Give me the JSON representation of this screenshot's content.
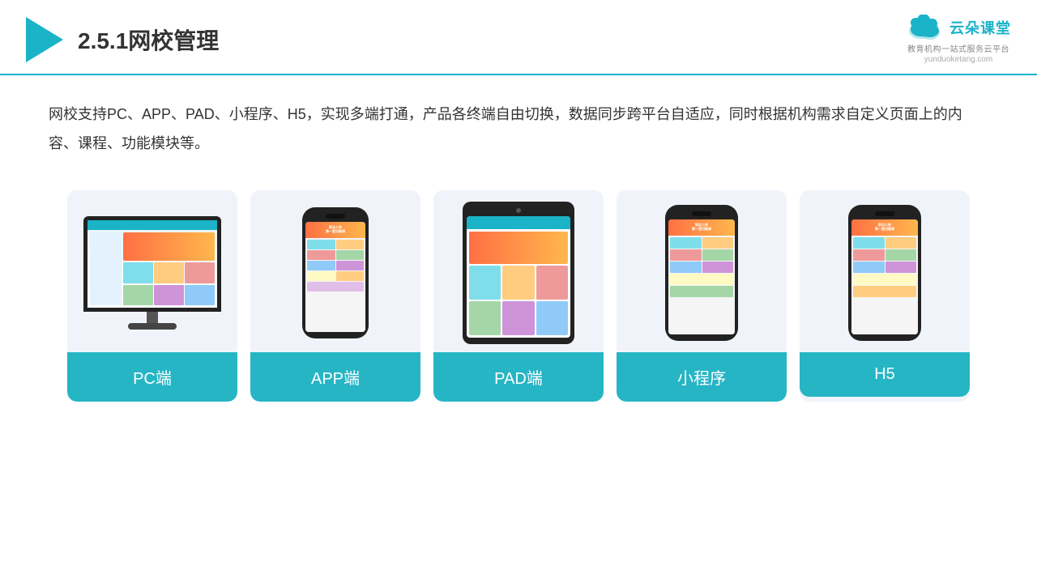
{
  "header": {
    "title": "2.5.1网校管理",
    "brand": {
      "name": "云朵课堂",
      "url": "yunduoketang.com",
      "tagline": "教育机构一站式服务云平台"
    }
  },
  "description": "网校支持PC、APP、PAD、小程序、H5，实现多端打通，产品各终端自由切换，数据同步跨平台自适应，同时根据机构需求自定义页面上的内容、课程、功能模块等。",
  "cards": [
    {
      "id": "pc",
      "label": "PC端"
    },
    {
      "id": "app",
      "label": "APP端"
    },
    {
      "id": "pad",
      "label": "PAD端"
    },
    {
      "id": "miniprogram",
      "label": "小程序"
    },
    {
      "id": "h5",
      "label": "H5"
    }
  ],
  "label_color": "#26b5c4"
}
